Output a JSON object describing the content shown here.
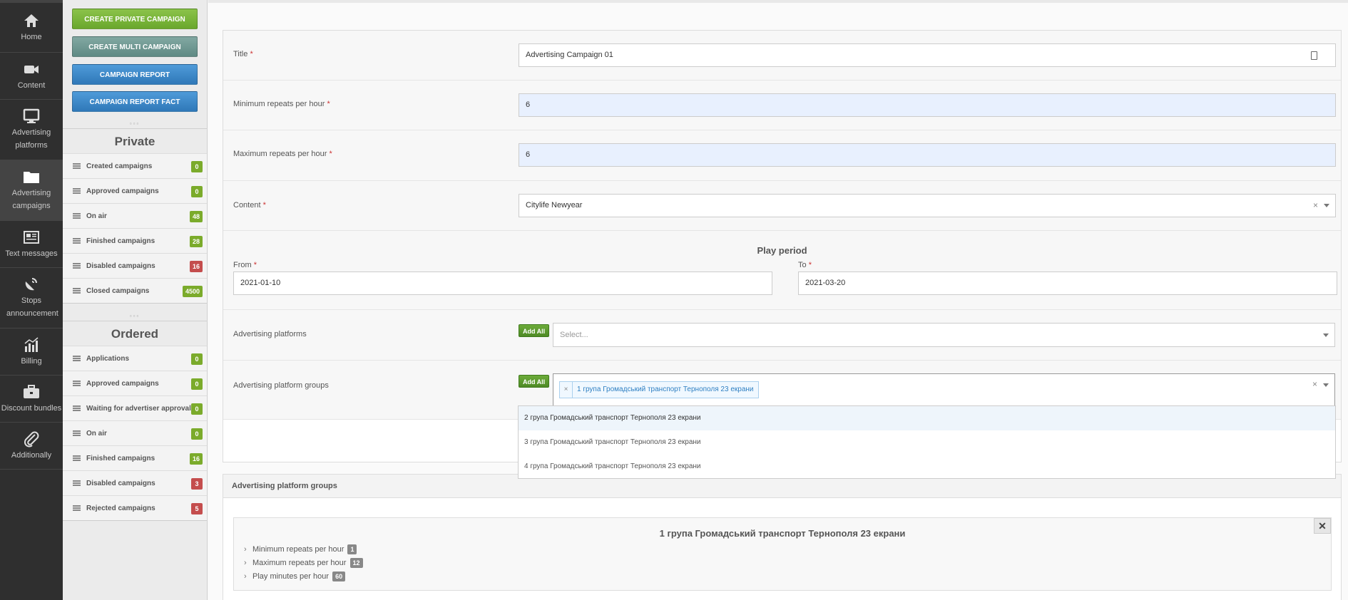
{
  "nav": [
    {
      "label": "Home",
      "icon": "home-icon"
    },
    {
      "label": "Content",
      "icon": "video-camera-icon"
    },
    {
      "label": "Advertising platforms",
      "icon": "monitor-icon"
    },
    {
      "label": "Advertising campaigns",
      "icon": "folder-icon"
    },
    {
      "label": "Text messages",
      "icon": "newspaper-icon"
    },
    {
      "label": "Stops announcement",
      "icon": "satellite-dish-icon"
    },
    {
      "label": "Billing",
      "icon": "chart-icon"
    },
    {
      "label": "Discount bundles",
      "icon": "briefcase-icon"
    },
    {
      "label": "Additionally",
      "icon": "paperclip-icon"
    }
  ],
  "buttons": {
    "create_private": "CREATE PRIVATE CAMPAIGN",
    "create_multi": "CREATE MULTI CAMPAIGN",
    "report": "CAMPAIGN REPORT",
    "report_fact": "CAMPAIGN REPORT FACT"
  },
  "private": {
    "title": "Private",
    "items": [
      {
        "label": "Created campaigns",
        "count": "0",
        "color": "#7bab2b"
      },
      {
        "label": "Approved campaigns",
        "count": "0",
        "color": "#7bab2b"
      },
      {
        "label": "On air",
        "count": "48",
        "color": "#7bab2b"
      },
      {
        "label": "Finished campaigns",
        "count": "28",
        "color": "#7bab2b"
      },
      {
        "label": "Disabled campaigns",
        "count": "16",
        "color": "#c44d4d"
      },
      {
        "label": "Closed campaigns",
        "count": "4500",
        "color": "#7bab2b"
      }
    ]
  },
  "ordered": {
    "title": "Ordered",
    "items": [
      {
        "label": "Applications",
        "count": "0",
        "color": "#7bab2b"
      },
      {
        "label": "Approved campaigns",
        "count": "0",
        "color": "#7bab2b"
      },
      {
        "label": "Waiting for advertiser approval",
        "count": "0",
        "color": "#7bab2b"
      },
      {
        "label": "On air",
        "count": "0",
        "color": "#7bab2b"
      },
      {
        "label": "Finished campaigns",
        "count": "16",
        "color": "#7bab2b"
      },
      {
        "label": "Disabled campaigns",
        "count": "3",
        "color": "#c44d4d"
      },
      {
        "label": "Rejected campaigns",
        "count": "5",
        "color": "#c44d4d"
      }
    ]
  },
  "form": {
    "title_label": "Title",
    "title_value": "Advertising Campaign 01",
    "min_label": "Minimum repeats per hour",
    "min_value": "6",
    "max_label": "Maximum repeats per hour",
    "max_value": "6",
    "content_label": "Content",
    "content_value": "Citylife Newyear",
    "play_period": "Play period",
    "from_label": "From",
    "from_value": "2021-01-10",
    "to_label": "To",
    "to_value": "2021-03-20",
    "platforms_label": "Advertising platforms",
    "platforms_placeholder": "Select...",
    "groups_label": "Advertising platform groups",
    "add_all": "Add All",
    "selected_group": "1 група Громадський транспорт Тернополя 23 екрани",
    "required_mark": "*",
    "clear_mark": "×"
  },
  "dropdown": [
    "2 група Громадський транспорт Тернополя 23 екрани",
    "3 група Громадський транспорт Тернополя 23 екрани",
    "4 група Громадський транспорт Тернополя 23 екрани"
  ],
  "groups_panel": {
    "header": "Advertising platform groups",
    "card_title": "1 група Громадський транспорт Тернополя 23 екрани",
    "close": "✕",
    "stats": [
      {
        "label": "Minimum repeats per hour",
        "value": "1"
      },
      {
        "label": "Maximum repeats per hour",
        "value": "12"
      },
      {
        "label": "Play minutes per hour",
        "value": "60"
      }
    ]
  }
}
